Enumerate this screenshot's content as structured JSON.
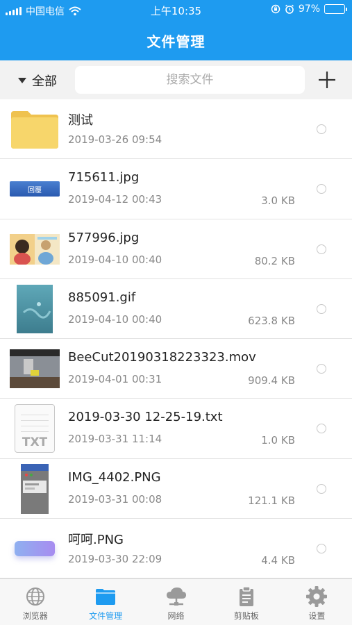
{
  "status_bar": {
    "carrier": "中国电信",
    "time": "上午10:35",
    "battery": "97%",
    "battery_level": 0.97,
    "icons": [
      "signal-icon",
      "wifi-icon",
      "rotation-lock-icon",
      "alarm-icon",
      "battery-icon"
    ]
  },
  "header": {
    "title": "文件管理"
  },
  "filter": {
    "selected": "全部",
    "search_placeholder": "搜索文件",
    "add_icon": "plus-icon"
  },
  "files": [
    {
      "name": "测试",
      "date": "2019-03-26 09:54",
      "size": "",
      "thumb": "folder"
    },
    {
      "name": "715611.jpg",
      "date": "2019-04-12 00:43",
      "size": "3.0 KB",
      "thumb": "button",
      "thumb_label": "回覆"
    },
    {
      "name": "577996.jpg",
      "date": "2019-04-10 00:40",
      "size": "80.2 KB",
      "thumb": "photo"
    },
    {
      "name": "885091.gif",
      "date": "2019-04-10 00:40",
      "size": "623.8 KB",
      "thumb": "gif"
    },
    {
      "name": "BeeCut20190318223323.mov",
      "date": "2019-04-01 00:31",
      "size": "909.4 KB",
      "thumb": "video"
    },
    {
      "name": "2019-03-30 12-25-19.txt",
      "date": "2019-03-31 11:14",
      "size": "1.0 KB",
      "thumb": "txt",
      "thumb_label": "TXT"
    },
    {
      "name": "IMG_4402.PNG",
      "date": "2019-03-31 00:08",
      "size": "121.1 KB",
      "thumb": "screenshot"
    },
    {
      "name": "呵呵.PNG",
      "date": "2019-03-30 22:09",
      "size": "4.4 KB",
      "thumb": "gradient"
    }
  ],
  "tabs": [
    {
      "label": "浏览器",
      "icon": "globe-icon",
      "active": false
    },
    {
      "label": "文件管理",
      "icon": "folder-icon",
      "active": true
    },
    {
      "label": "网络",
      "icon": "cloud-network-icon",
      "active": false
    },
    {
      "label": "剪贴板",
      "icon": "clipboard-icon",
      "active": false
    },
    {
      "label": "设置",
      "icon": "gear-icon",
      "active": false
    }
  ],
  "colors": {
    "accent": "#1E9BF0",
    "folder": "#F7D66B",
    "inactive_icon": "#9a9a9a"
  }
}
